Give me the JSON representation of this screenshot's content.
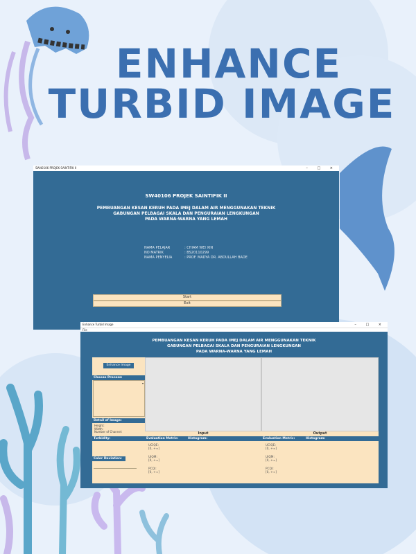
{
  "poster": {
    "title_line1": "ENHANCE",
    "title_line2": "TURBID IMAGE",
    "title_color": "#3b6fb0",
    "background_color": "#e9f1fb"
  },
  "window1": {
    "titlebar_text": "SW40106 PROJEK SAINTIFIK II",
    "controls": "–  □  ×",
    "course": "SW40106 PROJEK SAINTIFIK II",
    "title_lines": [
      "PEMBUANGAN KESAN KERUH PADA IMEJ DALAM AIR MENGGUNAKAN TEKNIK",
      "GABUNGAN PELBAGAI SKALA DAN PENGURAIAN LENGKUNGAN",
      "PADA WARNA-WARNA YANG LEMAH"
    ],
    "info": [
      {
        "key": "NAMA PELAJAR",
        "value": ": CHIAM WEI XIN"
      },
      {
        "key": "NO MATRIK",
        "value": ": BS20110299"
      },
      {
        "key": "NAMA PENYELIA",
        "value": ": PROF. MADYA DR. ABDULLAH BADE"
      }
    ],
    "start_label": "Start",
    "exit_label": "Exit",
    "accent_color": "#336b95",
    "button_color": "#fbe4c0"
  },
  "window2": {
    "titlebar_text": "Enhance Turbid Image",
    "controls": "–  □  ×",
    "menu": "File",
    "title_lines": [
      "PEMBUANGAN KESAN KERUH PADA IMEJ DALAM AIR MENGGUNAKAN TEKNIK",
      "GABUNGAN PELBAGAI SKALA DAN PENGURAIAN LENGKUNGAN",
      "PADA WARNA-WARNA YANG LEMAH"
    ],
    "enhance_button": "Enhance Image",
    "choose_process_label": "Choose Process:",
    "detail_label": "Detail of Image:",
    "detail_lines": [
      "Height:",
      "Width:",
      "Number of Channel:"
    ],
    "input_label": "Input",
    "output_label": "Output",
    "turbidity_label": "Turbidity:",
    "color_label": "Color Deviation:",
    "eval_metric_label": "Evaluation Metric:",
    "histogram_label": "Histogram:",
    "metrics_input": [
      {
        "name": "UCIQE:",
        "range": "[0, +∞]"
      },
      {
        "name": "UIQM:",
        "range": "[0, +∞]"
      },
      {
        "name": "PCQI:",
        "range": "[0, +∞]"
      }
    ],
    "metrics_output": [
      {
        "name": "UCIQE:",
        "range": "[0, +∞]"
      },
      {
        "name": "UIQM:",
        "range": "[0, +∞]"
      },
      {
        "name": "PCQI:",
        "range": "[0, +∞]"
      }
    ]
  }
}
